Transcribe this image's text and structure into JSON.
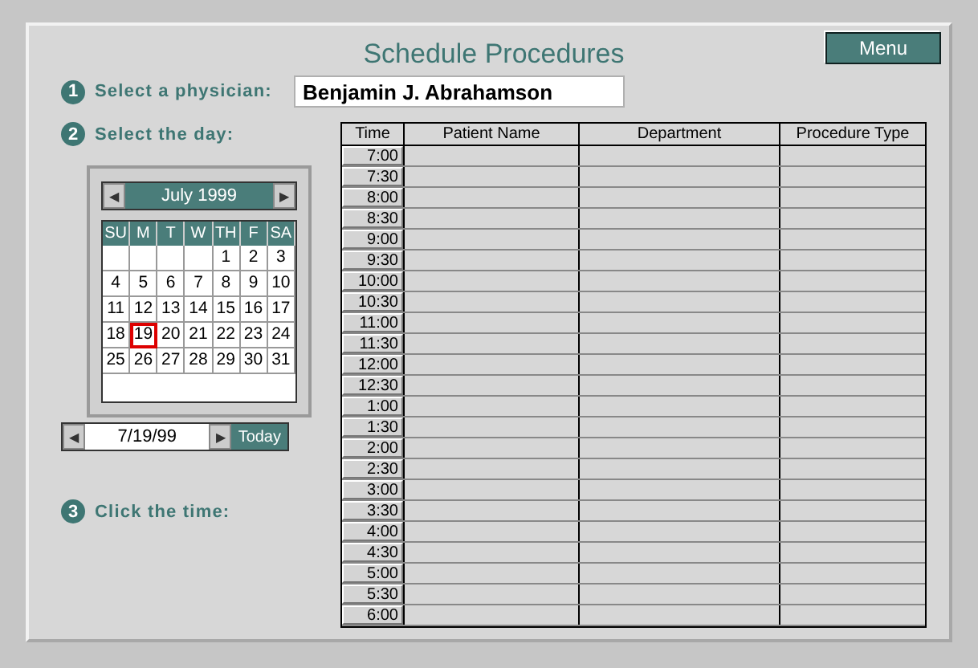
{
  "title": "Schedule Procedures",
  "menu_button": "Menu",
  "steps": [
    {
      "number": "1",
      "label": "Select a physician:"
    },
    {
      "number": "2",
      "label": "Select the day:"
    },
    {
      "number": "3",
      "label": "Click the time:"
    }
  ],
  "physician": {
    "value": "Benjamin J. Abrahamson"
  },
  "calendar": {
    "month": "July 1999",
    "prev": "◀",
    "next": "▶",
    "weekdays": [
      "SU",
      "M",
      "T",
      "W",
      "TH",
      "F",
      "SA"
    ],
    "weeks": [
      {
        "kind": "late-start",
        "days": [
          {
            "label": "1",
            "selected": false
          },
          {
            "label": "2",
            "selected": false
          },
          {
            "label": "3",
            "selected": false
          }
        ]
      },
      {
        "kind": "full",
        "days": [
          {
            "label": "4",
            "selected": false
          },
          {
            "label": "5",
            "selected": false
          },
          {
            "label": "6",
            "selected": false
          },
          {
            "label": "7",
            "selected": false
          },
          {
            "label": "8",
            "selected": false
          },
          {
            "label": "9",
            "selected": false
          },
          {
            "label": "10",
            "selected": false
          }
        ]
      },
      {
        "kind": "full",
        "days": [
          {
            "label": "11",
            "selected": false
          },
          {
            "label": "12",
            "selected": false
          },
          {
            "label": "13",
            "selected": false
          },
          {
            "label": "14",
            "selected": false
          },
          {
            "label": "15",
            "selected": false
          },
          {
            "label": "16",
            "selected": false
          },
          {
            "label": "17",
            "selected": false
          }
        ]
      },
      {
        "kind": "full",
        "days": [
          {
            "label": "18",
            "selected": false
          },
          {
            "label": "19",
            "selected": true
          },
          {
            "label": "20",
            "selected": false
          },
          {
            "label": "21",
            "selected": false
          },
          {
            "label": "22",
            "selected": false
          },
          {
            "label": "23",
            "selected": false
          },
          {
            "label": "24",
            "selected": false
          }
        ]
      },
      {
        "kind": "full",
        "days": [
          {
            "label": "25",
            "selected": false
          },
          {
            "label": "26",
            "selected": false
          },
          {
            "label": "27",
            "selected": false
          },
          {
            "label": "28",
            "selected": false
          },
          {
            "label": "29",
            "selected": false
          },
          {
            "label": "30",
            "selected": false
          },
          {
            "label": "31",
            "selected": false
          }
        ]
      }
    ],
    "date": "7/19/99",
    "today_button": "Today"
  },
  "table": {
    "columns": [
      "Time",
      "Patient Name",
      "Department",
      "Procedure Type"
    ],
    "times": [
      "7:00",
      "7:30",
      "8:00",
      "8:30",
      "9:00",
      "9:30",
      "10:00",
      "10:30",
      "11:00",
      "11:30",
      "12:00",
      "12:30",
      "1:00",
      "1:30",
      "2:00",
      "2:30",
      "3:00",
      "3:30",
      "4:00",
      "4:30",
      "5:00",
      "5:30",
      "6:00"
    ]
  }
}
